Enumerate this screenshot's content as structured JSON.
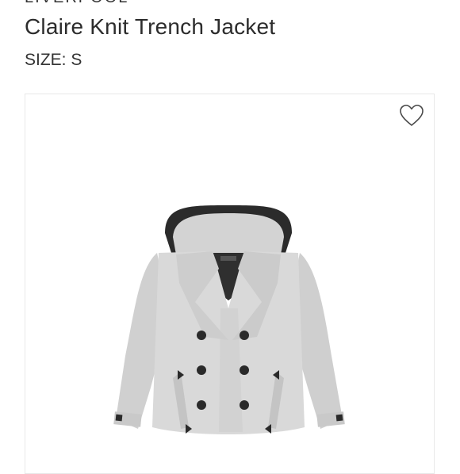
{
  "product": {
    "brand": "LIVERPOOL",
    "title": "Claire Knit Trench Jacket",
    "size_label": "SIZE: S"
  },
  "image": {
    "favorite_icon": "heart-outline-icon",
    "coat_color": "#d6d6d6",
    "hood_lining_color": "#2b2b2b",
    "button_color": "#2a2a2a"
  }
}
